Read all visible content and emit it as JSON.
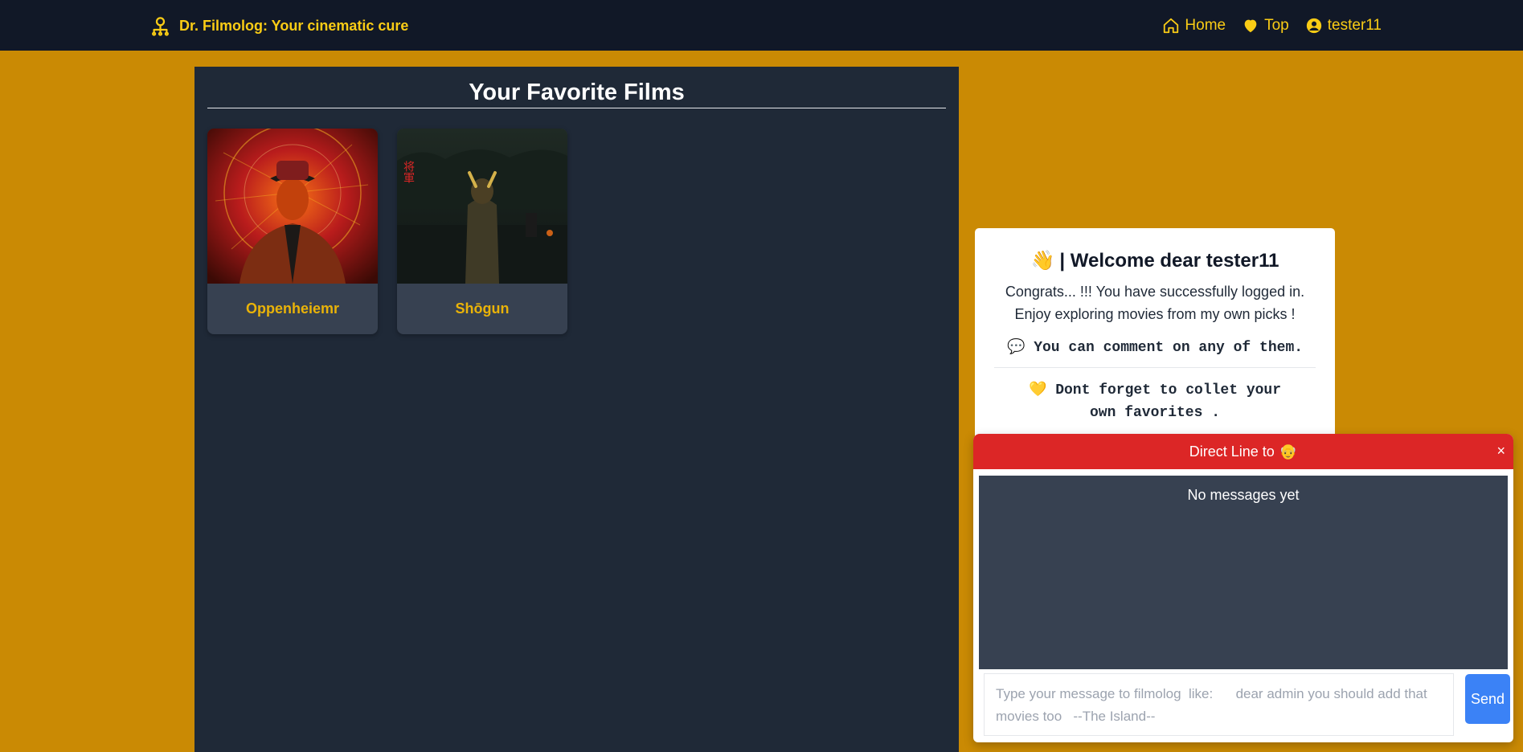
{
  "navbar": {
    "brand_icon": "user-network-icon",
    "brand": "Dr. Filmolog: Your cinematic cure",
    "links": [
      {
        "label": "Home",
        "icon": "home-icon"
      },
      {
        "label": "Top",
        "icon": "heart-icon"
      },
      {
        "label": "tester11",
        "icon": "user-circle-icon"
      }
    ],
    "accent_color": "#facc15"
  },
  "favorites": {
    "title": "Your Favorite Films",
    "films": [
      {
        "title": "Oppenheiemr"
      },
      {
        "title": "Shōgun",
        "poster_text": "将軍"
      }
    ]
  },
  "welcome": {
    "emoji": "👋",
    "title": "| Welcome dear tester11",
    "line1": "Congrats... !!! You have successfully logged in.",
    "line2": "Enjoy exploring movies from my own picks !",
    "comment_icon": "💬",
    "comment_tip": "You can comment on any of them.",
    "heart_icon": "💛",
    "favorites_tip": "Dont forget to collet your own favorites ."
  },
  "chat": {
    "header": "Direct Line to",
    "header_avatar": "👴",
    "close_label": "×",
    "empty_text": "No messages yet",
    "placeholder": "Type your message to filmolog  like:      dear admin you should add that movies too   --The Island--",
    "send_label": "Send",
    "header_color": "#dc2626",
    "send_color": "#3b82f6"
  }
}
